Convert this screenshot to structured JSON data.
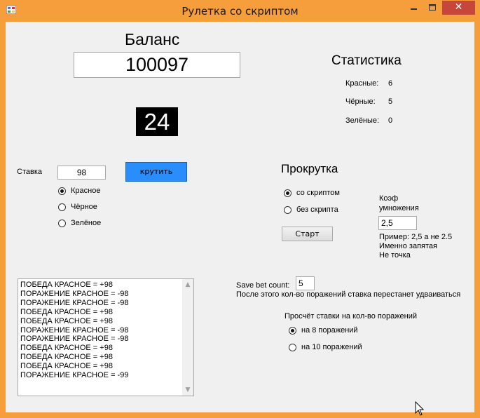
{
  "window": {
    "title": "Рулетка со скриптом",
    "close_glyph": "✕"
  },
  "balance": {
    "heading": "Баланс",
    "value": "100097"
  },
  "last_number": "24",
  "stats": {
    "heading": "Статистика",
    "rows": [
      {
        "label": "Красные:",
        "value": "6"
      },
      {
        "label": "Чёрные:",
        "value": "5"
      },
      {
        "label": "Зелёные:",
        "value": "0"
      }
    ]
  },
  "bet": {
    "label": "Ставка",
    "value": "98",
    "spin_label": "крутить",
    "colors": [
      {
        "label": "Красное",
        "checked": true
      },
      {
        "label": "Чёрное",
        "checked": false
      },
      {
        "label": "Зелёное",
        "checked": false
      }
    ]
  },
  "scroll_section": {
    "heading": "Прокрутка",
    "modes": [
      {
        "label": "со скриптом",
        "checked": true
      },
      {
        "label": "без скрипта",
        "checked": false
      }
    ],
    "start_label": "Старт",
    "coef_label_1": "Коэф",
    "coef_label_2": "умножения",
    "coef_value": "2,5",
    "hint_1": "Пример: 2,5 а не 2.5",
    "hint_2": "Именно запятая",
    "hint_3": "Не точка"
  },
  "save_bet": {
    "label": "Save bet count:",
    "value": "5",
    "note": "После этого кол-во поражений ставка перестанет удваиваться"
  },
  "calc": {
    "heading": "Просчёт ставки на кол-во поражений",
    "options": [
      {
        "label": "на 8 поражений",
        "checked": true
      },
      {
        "label": "на 10 поражений",
        "checked": false
      }
    ]
  },
  "log": [
    "ПОБЕДА КРАСНОЕ = +98",
    "ПОРАЖЕНИЕ КРАСНОЕ = -98",
    "ПОРАЖЕНИЕ КРАСНОЕ = -98",
    "ПОБЕДА КРАСНОЕ = +98",
    "ПОБЕДА КРАСНОЕ = +98",
    "ПОРАЖЕНИЕ КРАСНОЕ = -98",
    "ПОРАЖЕНИЕ КРАСНОЕ = -98",
    "ПОБЕДА КРАСНОЕ = +98",
    "ПОБЕДА КРАСНОЕ = +98",
    "ПОБЕДА КРАСНОЕ = +98",
    "ПОРАЖЕНИЕ КРАСНОЕ = -99"
  ],
  "colors": {
    "titlebar": "#f59e3b",
    "close": "#c7463a",
    "spin_button": "#2a8dfc",
    "client": "#f0f0f0"
  }
}
